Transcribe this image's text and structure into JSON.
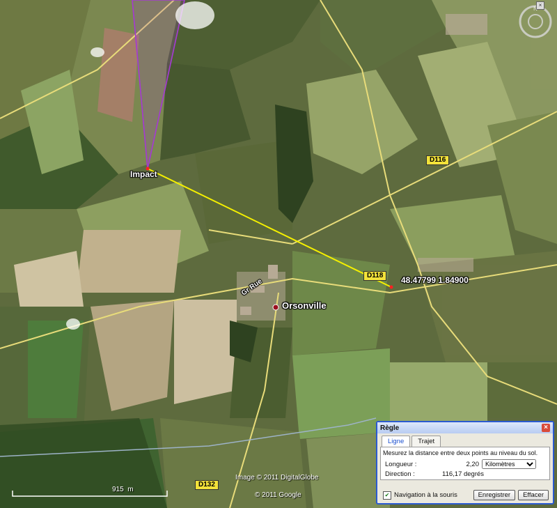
{
  "map": {
    "markers": {
      "impact": "Impact",
      "point": "48.47799 1.84900",
      "town": "Orsonville"
    },
    "roads": {
      "d116": "D116",
      "d118": "D118",
      "d132": "D132",
      "street": "Gr Rue"
    },
    "scale": {
      "distance": "915",
      "unit": "m"
    },
    "credits": {
      "imagery": "Image © 2011 DigitalGlobe",
      "google": "© 2011 Google"
    }
  },
  "ruler": {
    "title": "Règle",
    "tabs": [
      "Ligne",
      "Trajet"
    ],
    "description": "Mesurez la distance entre deux points au niveau du sol.",
    "length_label": "Longueur :",
    "length_value": "2,20",
    "unit": "Kilomètres",
    "direction_label": "Direction :",
    "direction_value": "116,17 degrés",
    "mouse_nav": "Navigation à la souris",
    "save": "Enregistrer",
    "clear": "Effacer"
  },
  "colors": {
    "measure_line": "#f5f000",
    "path_line": "#a43bd0",
    "road": "#e8dc7a",
    "dialog_border": "#2b5ad0"
  }
}
